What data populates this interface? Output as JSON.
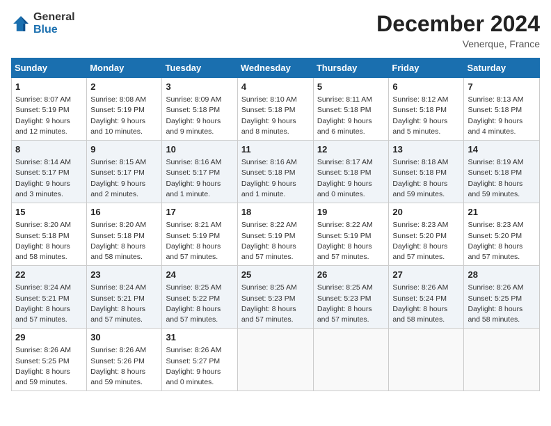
{
  "logo": {
    "general": "General",
    "blue": "Blue"
  },
  "title": "December 2024",
  "location": "Venerque, France",
  "days_of_week": [
    "Sunday",
    "Monday",
    "Tuesday",
    "Wednesday",
    "Thursday",
    "Friday",
    "Saturday"
  ],
  "weeks": [
    [
      {
        "day": "1",
        "sunrise": "8:07 AM",
        "sunset": "5:19 PM",
        "daylight": "9 hours and 12 minutes."
      },
      {
        "day": "2",
        "sunrise": "8:08 AM",
        "sunset": "5:19 PM",
        "daylight": "9 hours and 10 minutes."
      },
      {
        "day": "3",
        "sunrise": "8:09 AM",
        "sunset": "5:18 PM",
        "daylight": "9 hours and 9 minutes."
      },
      {
        "day": "4",
        "sunrise": "8:10 AM",
        "sunset": "5:18 PM",
        "daylight": "9 hours and 8 minutes."
      },
      {
        "day": "5",
        "sunrise": "8:11 AM",
        "sunset": "5:18 PM",
        "daylight": "9 hours and 6 minutes."
      },
      {
        "day": "6",
        "sunrise": "8:12 AM",
        "sunset": "5:18 PM",
        "daylight": "9 hours and 5 minutes."
      },
      {
        "day": "7",
        "sunrise": "8:13 AM",
        "sunset": "5:18 PM",
        "daylight": "9 hours and 4 minutes."
      }
    ],
    [
      {
        "day": "8",
        "sunrise": "8:14 AM",
        "sunset": "5:17 PM",
        "daylight": "9 hours and 3 minutes."
      },
      {
        "day": "9",
        "sunrise": "8:15 AM",
        "sunset": "5:17 PM",
        "daylight": "9 hours and 2 minutes."
      },
      {
        "day": "10",
        "sunrise": "8:16 AM",
        "sunset": "5:17 PM",
        "daylight": "9 hours and 1 minute."
      },
      {
        "day": "11",
        "sunrise": "8:16 AM",
        "sunset": "5:18 PM",
        "daylight": "9 hours and 1 minute."
      },
      {
        "day": "12",
        "sunrise": "8:17 AM",
        "sunset": "5:18 PM",
        "daylight": "9 hours and 0 minutes."
      },
      {
        "day": "13",
        "sunrise": "8:18 AM",
        "sunset": "5:18 PM",
        "daylight": "8 hours and 59 minutes."
      },
      {
        "day": "14",
        "sunrise": "8:19 AM",
        "sunset": "5:18 PM",
        "daylight": "8 hours and 59 minutes."
      }
    ],
    [
      {
        "day": "15",
        "sunrise": "8:20 AM",
        "sunset": "5:18 PM",
        "daylight": "8 hours and 58 minutes."
      },
      {
        "day": "16",
        "sunrise": "8:20 AM",
        "sunset": "5:18 PM",
        "daylight": "8 hours and 58 minutes."
      },
      {
        "day": "17",
        "sunrise": "8:21 AM",
        "sunset": "5:19 PM",
        "daylight": "8 hours and 57 minutes."
      },
      {
        "day": "18",
        "sunrise": "8:22 AM",
        "sunset": "5:19 PM",
        "daylight": "8 hours and 57 minutes."
      },
      {
        "day": "19",
        "sunrise": "8:22 AM",
        "sunset": "5:19 PM",
        "daylight": "8 hours and 57 minutes."
      },
      {
        "day": "20",
        "sunrise": "8:23 AM",
        "sunset": "5:20 PM",
        "daylight": "8 hours and 57 minutes."
      },
      {
        "day": "21",
        "sunrise": "8:23 AM",
        "sunset": "5:20 PM",
        "daylight": "8 hours and 57 minutes."
      }
    ],
    [
      {
        "day": "22",
        "sunrise": "8:24 AM",
        "sunset": "5:21 PM",
        "daylight": "8 hours and 57 minutes."
      },
      {
        "day": "23",
        "sunrise": "8:24 AM",
        "sunset": "5:21 PM",
        "daylight": "8 hours and 57 minutes."
      },
      {
        "day": "24",
        "sunrise": "8:25 AM",
        "sunset": "5:22 PM",
        "daylight": "8 hours and 57 minutes."
      },
      {
        "day": "25",
        "sunrise": "8:25 AM",
        "sunset": "5:23 PM",
        "daylight": "8 hours and 57 minutes."
      },
      {
        "day": "26",
        "sunrise": "8:25 AM",
        "sunset": "5:23 PM",
        "daylight": "8 hours and 57 minutes."
      },
      {
        "day": "27",
        "sunrise": "8:26 AM",
        "sunset": "5:24 PM",
        "daylight": "8 hours and 58 minutes."
      },
      {
        "day": "28",
        "sunrise": "8:26 AM",
        "sunset": "5:25 PM",
        "daylight": "8 hours and 58 minutes."
      }
    ],
    [
      {
        "day": "29",
        "sunrise": "8:26 AM",
        "sunset": "5:25 PM",
        "daylight": "8 hours and 59 minutes."
      },
      {
        "day": "30",
        "sunrise": "8:26 AM",
        "sunset": "5:26 PM",
        "daylight": "8 hours and 59 minutes."
      },
      {
        "day": "31",
        "sunrise": "8:26 AM",
        "sunset": "5:27 PM",
        "daylight": "9 hours and 0 minutes."
      },
      null,
      null,
      null,
      null
    ]
  ],
  "labels": {
    "sunrise": "Sunrise:",
    "sunset": "Sunset:",
    "daylight": "Daylight:"
  }
}
